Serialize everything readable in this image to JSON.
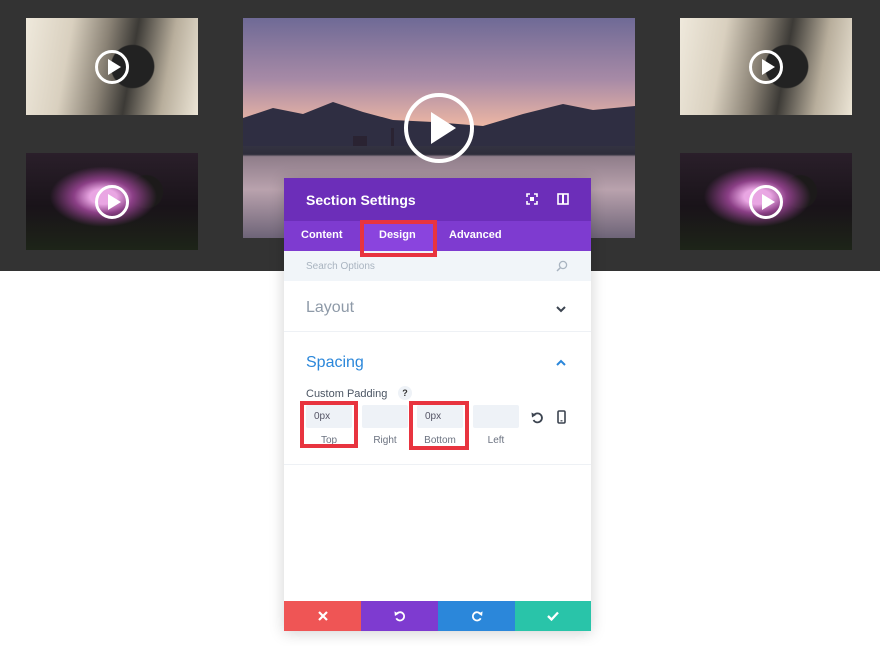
{
  "colors": {
    "header_purple": "#6c2eb9",
    "tab_purple": "#7e3bd0",
    "accent_blue": "#2b87da",
    "highlight_red": "#e8343f",
    "discard": "#ef5555",
    "undo": "#7e3bd0",
    "redo": "#2b87da",
    "save": "#29c4a9"
  },
  "gallery": {
    "thumbnails": [
      {
        "name": "camera-thumbnail",
        "icon": "play-icon"
      },
      {
        "name": "concert-thumbnail",
        "icon": "play-icon"
      },
      {
        "name": "lake-thumbnail",
        "icon": "play-icon"
      },
      {
        "name": "camera-thumbnail",
        "icon": "play-icon"
      },
      {
        "name": "concert-thumbnail",
        "icon": "play-icon"
      }
    ]
  },
  "panel": {
    "title": "Section Settings",
    "header_icons": [
      "expand-icon",
      "sidebar-icon"
    ],
    "tabs": [
      {
        "label": "Content",
        "active": false
      },
      {
        "label": "Design",
        "active": true
      },
      {
        "label": "Advanced",
        "active": false
      }
    ],
    "search_placeholder": "Search Options",
    "sections": [
      {
        "title": "Layout",
        "expanded": false
      },
      {
        "title": "Spacing",
        "expanded": true
      }
    ],
    "spacing": {
      "field_label": "Custom Padding",
      "help_label": "?",
      "top_value": "0px",
      "right_value": "",
      "bottom_value": "0px",
      "left_value": "",
      "labels": {
        "top": "Top",
        "right": "Right",
        "bottom": "Bottom",
        "left": "Left"
      },
      "icons": [
        "reset-icon",
        "phone-icon"
      ]
    },
    "footer": [
      "discard-icon",
      "undo-icon",
      "redo-icon",
      "save-icon"
    ]
  }
}
